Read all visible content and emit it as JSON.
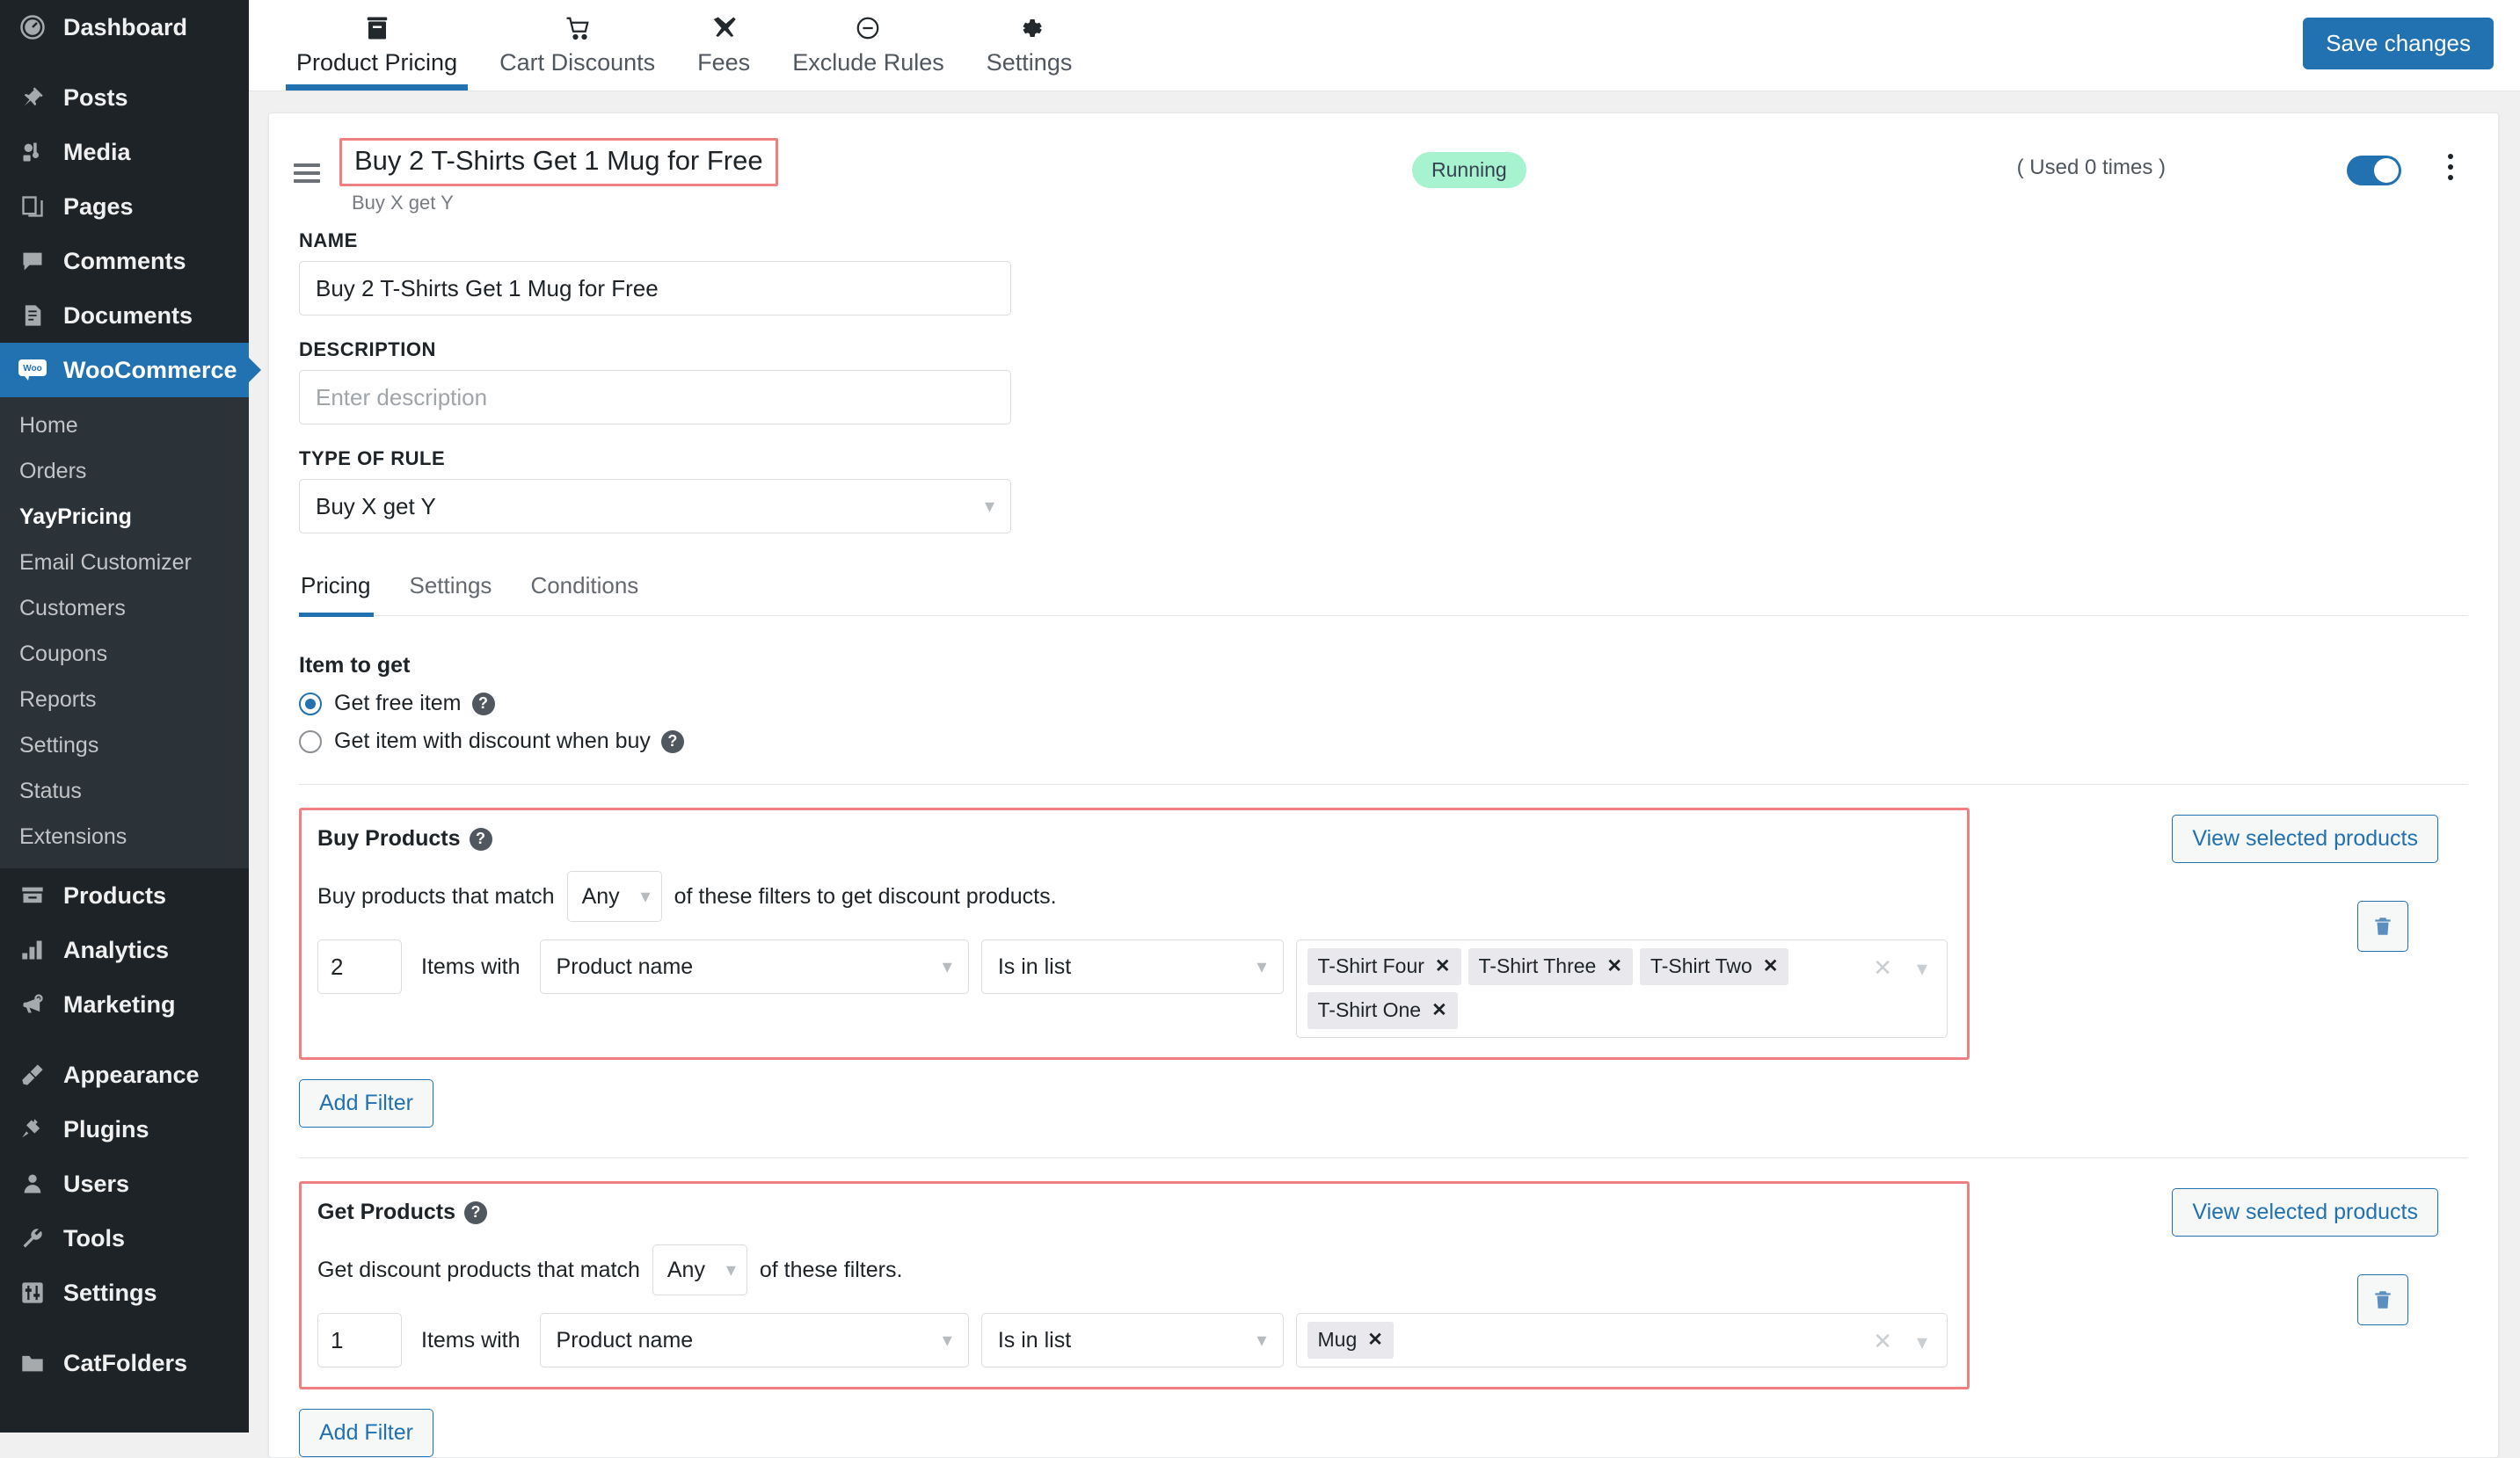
{
  "sidebar": {
    "items": [
      {
        "label": "Dashboard",
        "icon": "dashboard-icon"
      },
      {
        "label": "Posts",
        "icon": "pin-icon"
      },
      {
        "label": "Media",
        "icon": "media-icon"
      },
      {
        "label": "Pages",
        "icon": "pages-icon"
      },
      {
        "label": "Comments",
        "icon": "comment-icon"
      },
      {
        "label": "Documents",
        "icon": "document-icon"
      },
      {
        "label": "WooCommerce",
        "icon": "woo-icon"
      },
      {
        "label": "Products",
        "icon": "products-icon"
      },
      {
        "label": "Analytics",
        "icon": "analytics-icon"
      },
      {
        "label": "Marketing",
        "icon": "megaphone-icon"
      },
      {
        "label": "Appearance",
        "icon": "brush-icon"
      },
      {
        "label": "Plugins",
        "icon": "plug-icon"
      },
      {
        "label": "Users",
        "icon": "user-icon"
      },
      {
        "label": "Tools",
        "icon": "wrench-icon"
      },
      {
        "label": "Settings",
        "icon": "sliders-icon"
      },
      {
        "label": "CatFolders",
        "icon": "folder-icon"
      }
    ],
    "woo_submenu": [
      {
        "label": "Home"
      },
      {
        "label": "Orders"
      },
      {
        "label": "YayPricing"
      },
      {
        "label": "Email Customizer"
      },
      {
        "label": "Customers"
      },
      {
        "label": "Coupons"
      },
      {
        "label": "Reports"
      },
      {
        "label": "Settings"
      },
      {
        "label": "Status"
      },
      {
        "label": "Extensions"
      }
    ]
  },
  "topbar": {
    "tabs": [
      {
        "label": "Product Pricing",
        "icon": "box-icon"
      },
      {
        "label": "Cart Discounts",
        "icon": "cart-icon"
      },
      {
        "label": "Fees",
        "icon": "plane-icon"
      },
      {
        "label": "Exclude Rules",
        "icon": "minus-circle-icon"
      },
      {
        "label": "Settings",
        "icon": "gear-icon"
      }
    ],
    "save_label": "Save changes"
  },
  "rule_header": {
    "title": "Buy 2 T-Shirts Get 1 Mug for Free",
    "subtitle": "Buy X get Y",
    "status": "Running",
    "usage": "( Used 0 times )",
    "enabled": true
  },
  "form": {
    "name_label": "NAME",
    "name_value": "Buy 2 T-Shirts Get 1 Mug for Free",
    "description_label": "DESCRIPTION",
    "description_value": "",
    "description_placeholder": "Enter description",
    "type_label": "TYPE OF RULE",
    "type_value": "Buy X get Y"
  },
  "inner_tabs": [
    {
      "label": "Pricing",
      "active": true
    },
    {
      "label": "Settings",
      "active": false
    },
    {
      "label": "Conditions",
      "active": false
    }
  ],
  "item_to_get": {
    "title": "Item to get",
    "options": [
      {
        "label": "Get free item",
        "checked": true
      },
      {
        "label": "Get item with discount when buy",
        "checked": false
      }
    ],
    "help_glyph": "?"
  },
  "buy_products": {
    "title": "Buy Products",
    "match_prefix": "Buy products that match",
    "match_value": "Any",
    "match_suffix": "of these filters to get discount products.",
    "filter": {
      "quantity": "2",
      "items_with_label": "Items with",
      "attribute": "Product name",
      "operator": "Is in list",
      "chips": [
        "T-Shirt Four",
        "T-Shirt Three",
        "T-Shirt Two",
        "T-Shirt One"
      ]
    },
    "add_filter_label": "Add Filter",
    "view_selected_label": "View selected products"
  },
  "get_products": {
    "title": "Get Products",
    "match_prefix": "Get discount products that match",
    "match_value": "Any",
    "match_suffix": "of these filters.",
    "filter": {
      "quantity": "1",
      "items_with_label": "Items with",
      "attribute": "Product name",
      "operator": "Is in list",
      "chips": [
        "Mug"
      ]
    },
    "add_filter_label": "Add Filter",
    "view_selected_label": "View selected products"
  },
  "colors": {
    "accent": "#2271b1",
    "highlight_border": "#f08080",
    "status_bg": "#a7f3d0",
    "sidebar_bg": "#1d2327"
  }
}
